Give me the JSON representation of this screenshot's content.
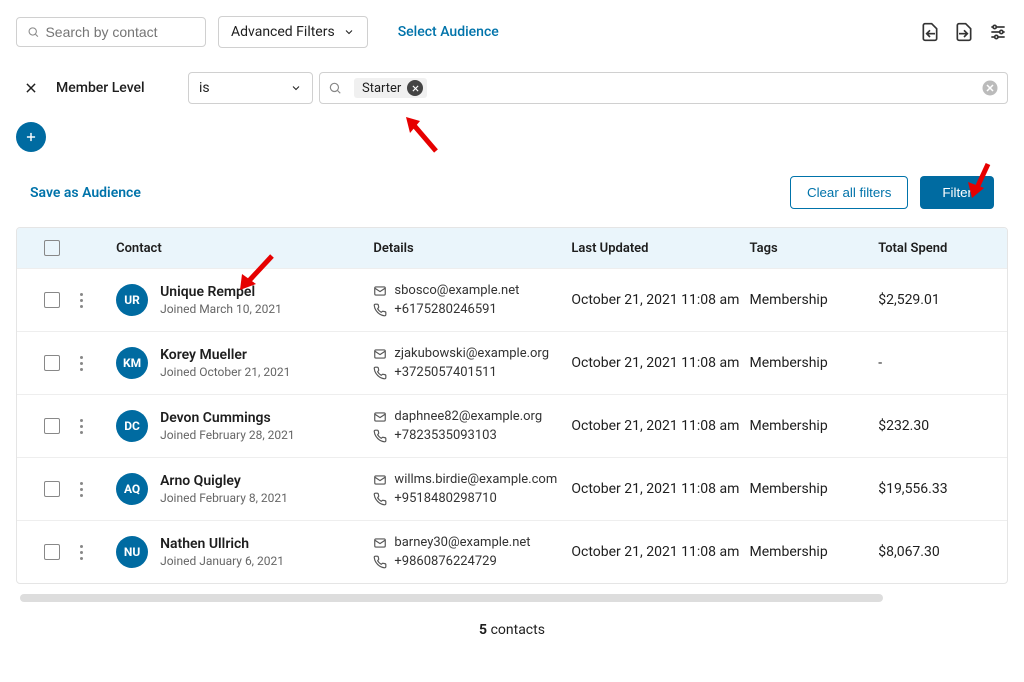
{
  "top": {
    "search_placeholder": "Search by contact",
    "advanced_filters": "Advanced Filters",
    "select_audience": "Select Audience"
  },
  "filter": {
    "field": "Member Level",
    "operator": "is",
    "chip": "Starter"
  },
  "actions": {
    "save_audience": "Save as Audience",
    "clear_all": "Clear all filters",
    "filter": "Filter"
  },
  "columns": {
    "contact": "Contact",
    "details": "Details",
    "updated": "Last Updated",
    "tags": "Tags",
    "spend": "Total Spend"
  },
  "rows": [
    {
      "initials": "UR",
      "name": "Unique Rempel",
      "joined": "Joined March 10, 2021",
      "email": "sbosco@example.net",
      "phone": "+6175280246591",
      "updated": "October 21, 2021 11:08 am",
      "tags": "Membership",
      "spend": "$2,529.01"
    },
    {
      "initials": "KM",
      "name": "Korey Mueller",
      "joined": "Joined October 21, 2021",
      "email": "zjakubowski@example.org",
      "phone": "+3725057401511",
      "updated": "October 21, 2021 11:08 am",
      "tags": "Membership",
      "spend": "-"
    },
    {
      "initials": "DC",
      "name": "Devon Cummings",
      "joined": "Joined February 28, 2021",
      "email": "daphnee82@example.org",
      "phone": "+7823535093103",
      "updated": "October 21, 2021 11:08 am",
      "tags": "Membership",
      "spend": "$232.30"
    },
    {
      "initials": "AQ",
      "name": "Arno Quigley",
      "joined": "Joined February 8, 2021",
      "email": "willms.birdie@example.com",
      "phone": "+9518480298710",
      "updated": "October 21, 2021 11:08 am",
      "tags": "Membership",
      "spend": "$19,556.33"
    },
    {
      "initials": "NU",
      "name": "Nathen Ullrich",
      "joined": "Joined January 6, 2021",
      "email": "barney30@example.net",
      "phone": "+9860876224729",
      "updated": "October 21, 2021 11:08 am",
      "tags": "Membership",
      "spend": "$8,067.30"
    }
  ],
  "footer": {
    "count": "5",
    "label": " contacts"
  }
}
